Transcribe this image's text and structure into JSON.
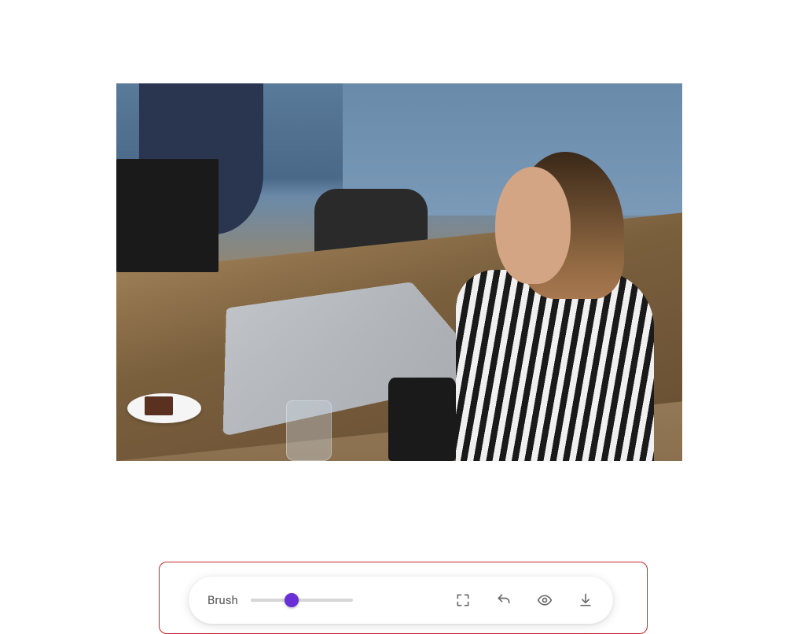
{
  "image": {
    "alt": "Photograph of a woman in a black-and-white striped shirt using a laptop at a wooden cafe table, with a monitor, backpack, plate with cake, glass of water, and camera visible"
  },
  "toolbar": {
    "brush_label": "Brush",
    "slider": {
      "min": 0,
      "max": 100,
      "value": 40
    },
    "icons": {
      "fullscreen": "fullscreen-icon",
      "undo": "undo-icon",
      "preview": "eye-icon",
      "download": "download-icon"
    }
  },
  "highlight": {
    "color": "#c1282d"
  }
}
